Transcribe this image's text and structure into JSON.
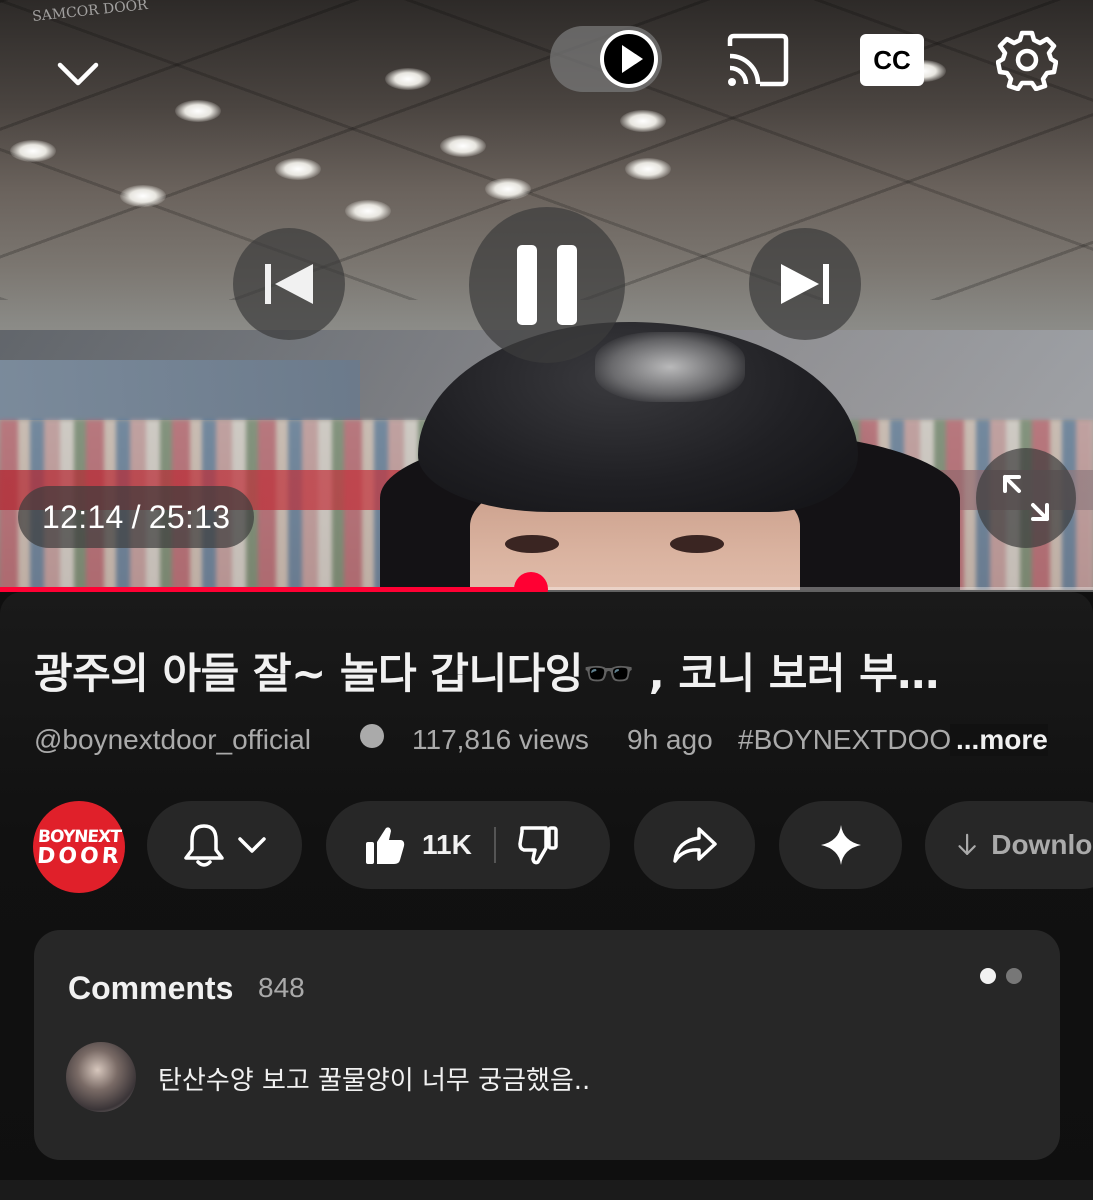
{
  "player": {
    "watermark": "SAMCOR DOOR",
    "current_time": "12:14",
    "separator": "/",
    "duration": "25:13",
    "progress": 0.486,
    "autoplay_on": true,
    "icons": {
      "collapse": "chevron-down-icon",
      "autoplay": "play-icon",
      "cast": "cast-icon",
      "captions": "cc-icon",
      "settings": "gear-icon",
      "previous": "skip-previous-icon",
      "pause": "pause-icon",
      "next": "skip-next-icon",
      "fullscreen": "fullscreen-icon"
    },
    "captions_label": "CC",
    "accent_color": "#ff0033"
  },
  "video": {
    "title": "광주의 아들 잘~ 놀다 갑니다잉🕶️ , 코니 보러 부…",
    "channel": "@boynextdoor_official",
    "views": "117,816 views",
    "age": "9h ago",
    "hashtag": "#BOYNEXTDOOR",
    "more_label": "...more"
  },
  "actions": {
    "avatar_text_line1": "BOYNEXT",
    "avatar_text_line2": "DOOR",
    "avatar_color": "#e0202a",
    "like_count": "11K",
    "download_label": "Download"
  },
  "comments": {
    "title": "Comments",
    "count": "848",
    "top_comment": "탄산수양 보고 꿀물양이 너무 궁금했음.."
  }
}
